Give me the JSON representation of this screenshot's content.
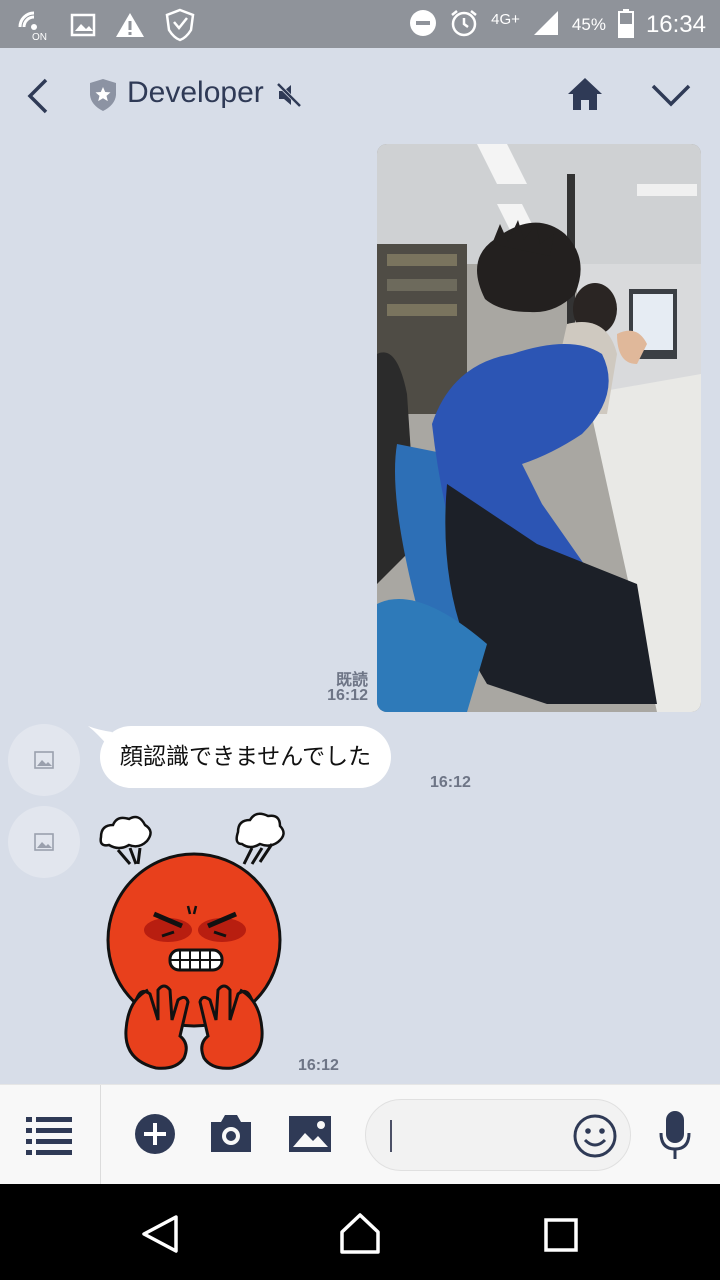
{
  "status_bar": {
    "nfc_label": "ON",
    "network": "4G+",
    "battery": "45%",
    "time": "16:34"
  },
  "header": {
    "title": "Developer"
  },
  "messages": {
    "photo": {
      "read_label": "既読",
      "time": "16:12"
    },
    "text": {
      "body": "顔認識できませんでした",
      "time": "16:12"
    },
    "sticker": {
      "time": "16:12"
    }
  },
  "input": {
    "placeholder": ""
  },
  "colors": {
    "background": "#d7dde8",
    "icon": "#2f3a56",
    "status_bar": "#8f939a",
    "sticker_red": "#e8401c"
  }
}
